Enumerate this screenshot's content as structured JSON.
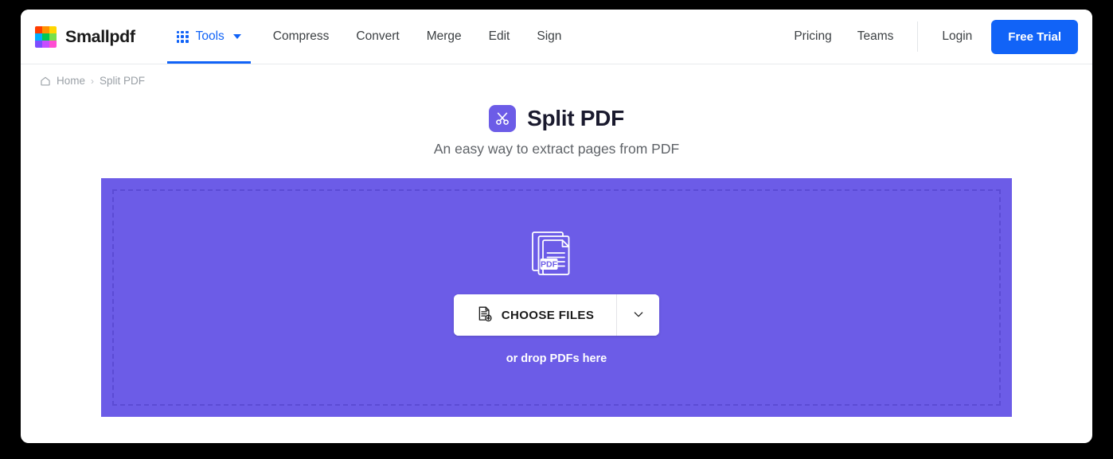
{
  "brand": {
    "name": "Smallpdf",
    "logo_colors": [
      "#ff3d00",
      "#ff9100",
      "#ffd600",
      "#00b0ff",
      "#00c853",
      "#76e04a",
      "#7c4dff",
      "#c64dff",
      "#ff4dd2"
    ]
  },
  "header": {
    "tools": {
      "label": "Tools",
      "icon": "grid-dots-icon",
      "caret": "chevron-down-icon",
      "active": true
    },
    "nav_links": [
      {
        "label": "Compress"
      },
      {
        "label": "Convert"
      },
      {
        "label": "Merge"
      },
      {
        "label": "Edit"
      },
      {
        "label": "Sign"
      }
    ],
    "right_links": [
      {
        "label": "Pricing"
      },
      {
        "label": "Teams"
      }
    ],
    "login_label": "Login",
    "cta_label": "Free Trial",
    "accent_color": "#1163f7"
  },
  "breadcrumb": {
    "home_icon": "home-icon",
    "home_label": "Home",
    "separator": "›",
    "current_label": "Split PDF"
  },
  "hero": {
    "badge_icon": "scissors-icon",
    "badge_color": "#6c5ce7",
    "title": "Split PDF",
    "subtitle": "An easy way to extract pages from PDF"
  },
  "dropzone": {
    "background_color": "#6c5ce7",
    "border_color": "#5b4bd4",
    "file_icon": "pdf-documents-stack-icon",
    "file_icon_label": "PDF",
    "choose_files_label": "CHOOSE FILES",
    "choose_files_icon": "document-add-icon",
    "dropdown_icon": "chevron-down-icon",
    "drop_hint": "or drop PDFs here"
  }
}
